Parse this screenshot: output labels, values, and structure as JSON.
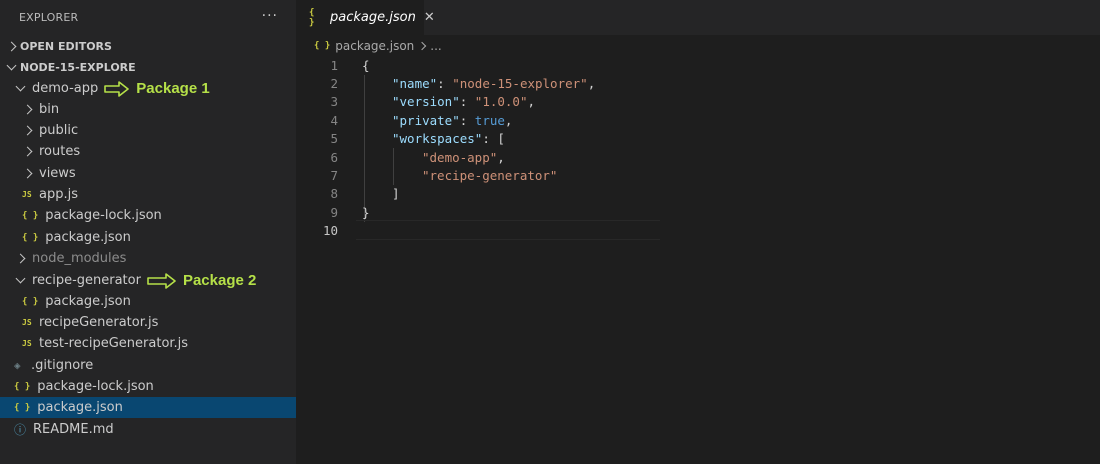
{
  "sidebar": {
    "title": "EXPLORER",
    "more_icon": "ellipsis-icon",
    "open_editors_label": "OPEN EDITORS",
    "workspace_label": "NODE-15-EXPLORE",
    "tree": [
      {
        "label": "demo-app",
        "annotation": "Package 1"
      },
      {
        "label": "bin"
      },
      {
        "label": "public"
      },
      {
        "label": "routes"
      },
      {
        "label": "views"
      },
      {
        "label": "app.js",
        "icon": "JS"
      },
      {
        "label": "package-lock.json",
        "icon": "{ }"
      },
      {
        "label": "package.json",
        "icon": "{ }"
      },
      {
        "label": "node_modules"
      },
      {
        "label": "recipe-generator",
        "annotation": "Package 2"
      },
      {
        "label": "package.json",
        "icon": "{ }"
      },
      {
        "label": "recipeGenerator.js",
        "icon": "JS"
      },
      {
        "label": "test-recipeGenerator.js",
        "icon": "JS"
      },
      {
        "label": ".gitignore",
        "icon": "◈"
      },
      {
        "label": "package-lock.json",
        "icon": "{ }"
      },
      {
        "label": "package.json",
        "icon": "{ }"
      },
      {
        "label": "README.md",
        "icon": "ⓘ"
      }
    ]
  },
  "editor": {
    "tab_label": "package.json",
    "tab_icon": "{ }",
    "tab_close": "✕",
    "breadcrumb_file": "package.json",
    "breadcrumb_more": "...",
    "line_numbers": [
      "1",
      "2",
      "3",
      "4",
      "5",
      "6",
      "7",
      "8",
      "9",
      "10"
    ],
    "code": {
      "l1_open": "{",
      "l2_key": "\"name\"",
      "l2_val": "\"node-15-explorer\"",
      "l3_key": "\"version\"",
      "l3_val": "\"1.0.0\"",
      "l4_key": "\"private\"",
      "l4_val": "true",
      "l5_key": "\"workspaces\"",
      "l5_bracket": "[",
      "l6_val": "\"demo-app\"",
      "l7_val": "\"recipe-generator\"",
      "l8_close": "]",
      "l9_close": "}",
      "colon": ": ",
      "comma": ","
    }
  },
  "colors": {
    "annotation": "#b5e048",
    "json_key": "#9cdcfe",
    "json_string": "#ce9178",
    "json_bool": "#569cd6",
    "selection": "#094771"
  }
}
